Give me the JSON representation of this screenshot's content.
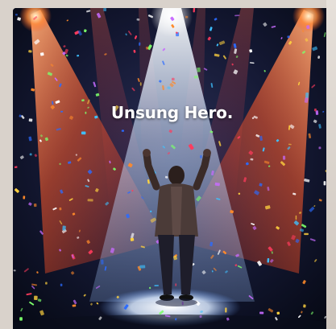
{
  "poster": {
    "title": "Unsung Hero."
  },
  "colors": {
    "background": "#0b1020",
    "spotlight_white": "#e8f4ff",
    "spotlight_orange": "#ff6a2a",
    "confetti": [
      "#ff3b5c",
      "#ffd23f",
      "#3ec1ff",
      "#7cff6b",
      "#ff8a2a",
      "#c86bff",
      "#ffffff",
      "#2b6bff"
    ]
  }
}
